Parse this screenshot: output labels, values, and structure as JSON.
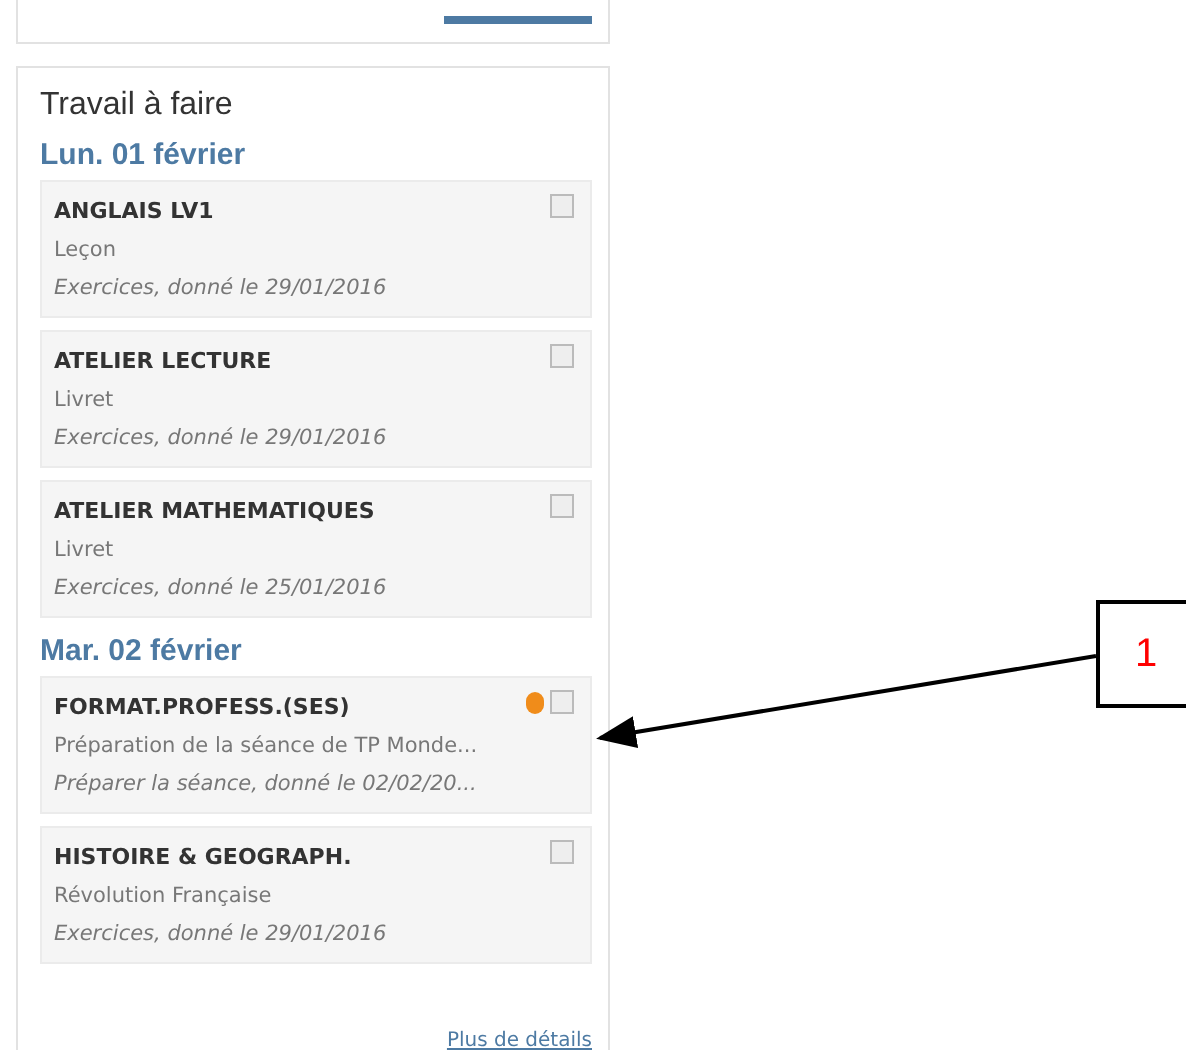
{
  "panel": {
    "title": "Travail à faire",
    "days": [
      {
        "date": "Lun. 01 février",
        "tasks": [
          {
            "subject": "ANGLAIS LV1",
            "description": "Leçon",
            "detail": "Exercices, donné le 29/01/2016",
            "checked": false,
            "warning": false
          },
          {
            "subject": "ATELIER LECTURE",
            "description": "Livret",
            "detail": "Exercices, donné le 29/01/2016",
            "checked": false,
            "warning": false
          },
          {
            "subject": "ATELIER MATHEMATIQUES",
            "description": "Livret",
            "detail": "Exercices, donné le 25/01/2016",
            "checked": false,
            "warning": false
          }
        ]
      },
      {
        "date": "Mar. 02 février",
        "tasks": [
          {
            "subject": "FORMAT.PROFESS.(SES)",
            "description": "Préparation de la séance de TP Monde...",
            "detail": "Préparer la séance, donné le 02/02/20...",
            "checked": false,
            "warning": true
          },
          {
            "subject": "HISTOIRE & GEOGRAPH.",
            "description": "Révolution Française",
            "detail": "Exercices, donné le 29/01/2016",
            "checked": false,
            "warning": false
          }
        ]
      }
    ],
    "link": "Plus de détails"
  },
  "callout": {
    "label": "1"
  }
}
